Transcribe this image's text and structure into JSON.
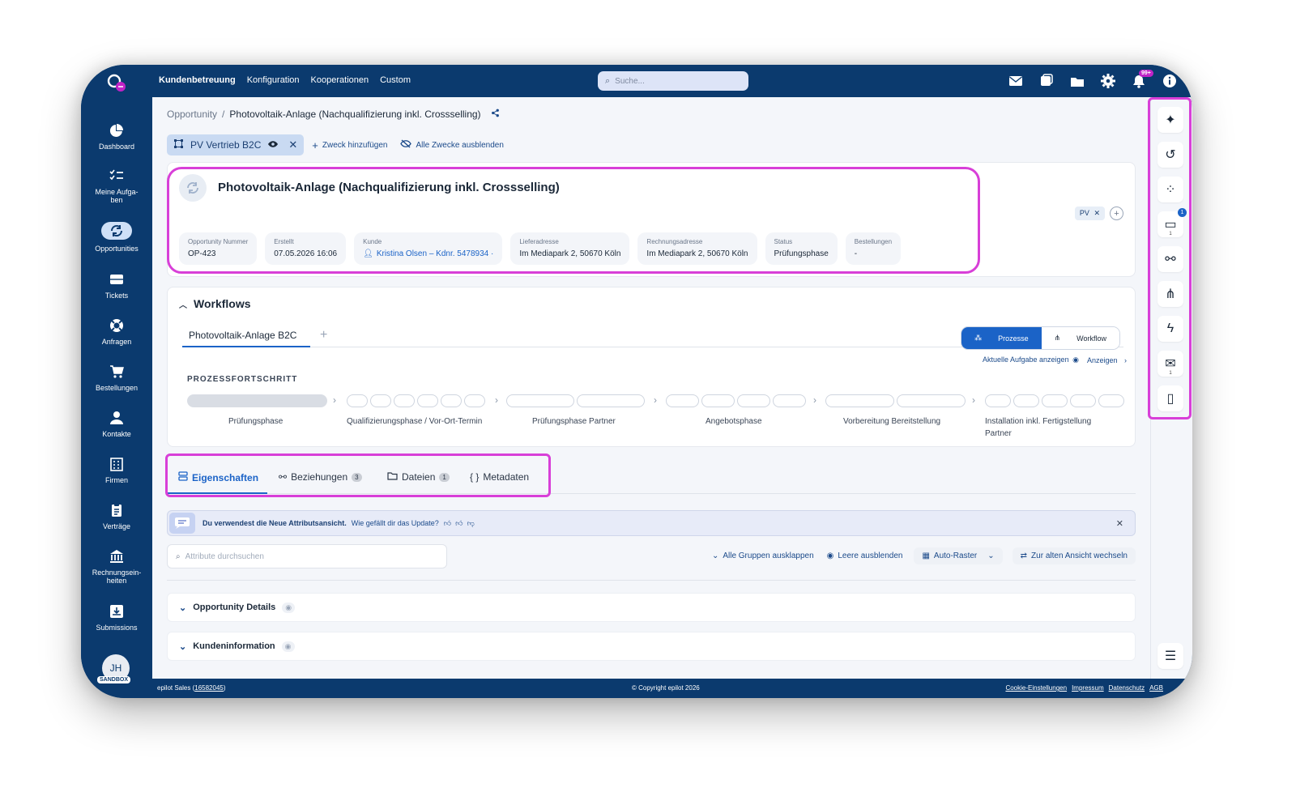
{
  "topnav": {
    "items": [
      "Kundenbetreuung",
      "Konfiguration",
      "Kooperationen",
      "Custom"
    ],
    "search_placeholder": "Suche...",
    "notification_badge": "99+"
  },
  "sidebar": {
    "items": [
      {
        "label": "Dashboard",
        "icon": "pie-chart-icon"
      },
      {
        "label": "Meine Aufga-\nben",
        "icon": "checklist-icon"
      },
      {
        "label": "Opportunities",
        "icon": "refresh-icon"
      },
      {
        "label": "Tickets",
        "icon": "ticket-icon"
      },
      {
        "label": "Anfragen",
        "icon": "lifebuoy-icon"
      },
      {
        "label": "Bestellungen",
        "icon": "cart-icon"
      },
      {
        "label": "Kontakte",
        "icon": "person-icon"
      },
      {
        "label": "Firmen",
        "icon": "building-icon"
      },
      {
        "label": "Verträge",
        "icon": "contract-icon"
      },
      {
        "label": "Rechnungsein-\nheiten",
        "icon": "bank-icon"
      },
      {
        "label": "Submissions",
        "icon": "inbox-icon"
      }
    ],
    "avatar_initials": "JH",
    "sandbox_label": "SANDBOX"
  },
  "breadcrumb": {
    "root": "Opportunity",
    "separator": "/",
    "current": "Photovoltaik-Anlage (Nachqualifizierung inkl. Crossselling)"
  },
  "purpose": {
    "chip_label": "PV Vertrieb B2C",
    "add_label": "Zweck hinzufügen",
    "hide_all_label": "Alle Zwecke ausblenden"
  },
  "header": {
    "title": "Photovoltaik-Anlage (Nachqualifizierung inkl. Crossselling)",
    "facts": [
      {
        "key": "Opportunity Nummer",
        "value": "OP-423"
      },
      {
        "key": "Erstellt",
        "value": "07.05.2026 16:06"
      },
      {
        "key": "Kunde",
        "value": "Kristina Olsen – Kdnr. 5478934 ·"
      },
      {
        "key": "Lieferadresse",
        "value": "Im Mediapark 2, 50670 Köln"
      },
      {
        "key": "Rechnungsadresse",
        "value": "Im Mediapark 2, 50670 Köln"
      },
      {
        "key": "Status",
        "value": "Prüfungsphase"
      },
      {
        "key": "Bestellungen",
        "value": "-"
      }
    ],
    "tag": "PV"
  },
  "workflows": {
    "title": "Workflows",
    "tab": "Photovoltaik-Anlage B2C",
    "toggle_processes": "Prozesse",
    "toggle_workflow": "Workflow",
    "show_current_task": "Aktuelle Aufgabe anzeigen",
    "show": "Anzeigen",
    "progress_label": "PROZESSFORTSCHRITT",
    "phases": [
      {
        "label": "Prüfungsphase",
        "dots": 1,
        "filled": 1
      },
      {
        "label": "Qualifizierungsphase / Vor-Ort-Termin",
        "dots": 6,
        "filled": 0
      },
      {
        "label": "Prüfungsphase Partner",
        "dots": 2,
        "filled": 0
      },
      {
        "label": "Angebotsphase",
        "dots": 4,
        "filled": 0
      },
      {
        "label": "Vorbereitung Bereitstellung",
        "dots": 2,
        "filled": 0
      },
      {
        "label": "Installation inkl. Fertigstellung Partner",
        "dots": 5,
        "filled": 0
      }
    ]
  },
  "tabs": [
    {
      "label": "Eigenschaften",
      "count": ""
    },
    {
      "label": "Beziehungen",
      "count": "3"
    },
    {
      "label": "Dateien",
      "count": "1"
    },
    {
      "label": "Metadaten",
      "count": ""
    }
  ],
  "notice": {
    "bold": "Du verwendest die Neue Attributsansicht.",
    "question": "Wie gefällt dir das Update?"
  },
  "attributes": {
    "search_placeholder": "Attribute durchsuchen",
    "expand_all": "Alle Gruppen ausklappen",
    "hide_empty": "Leere ausblenden",
    "auto_grid": "Auto-Raster",
    "old_view": "Zur alten Ansicht wechseln",
    "groups": [
      "Opportunity Details",
      "Kundeninformation"
    ]
  },
  "right_rail": {
    "notes_badge": "1",
    "notes_count": "1",
    "mail_count": "1"
  },
  "footer": {
    "left": "epilot Sales (",
    "org_id": "16582045",
    "left_close": ")",
    "copyright": "© Copyright epilot 2026",
    "links": [
      "Cookie-Einstellungen",
      "Impressum",
      "Datenschutz",
      "AGB"
    ]
  },
  "colors": {
    "brand": "#0b3a6e",
    "accent": "#1b63c7",
    "highlight": "#d83fd8"
  }
}
